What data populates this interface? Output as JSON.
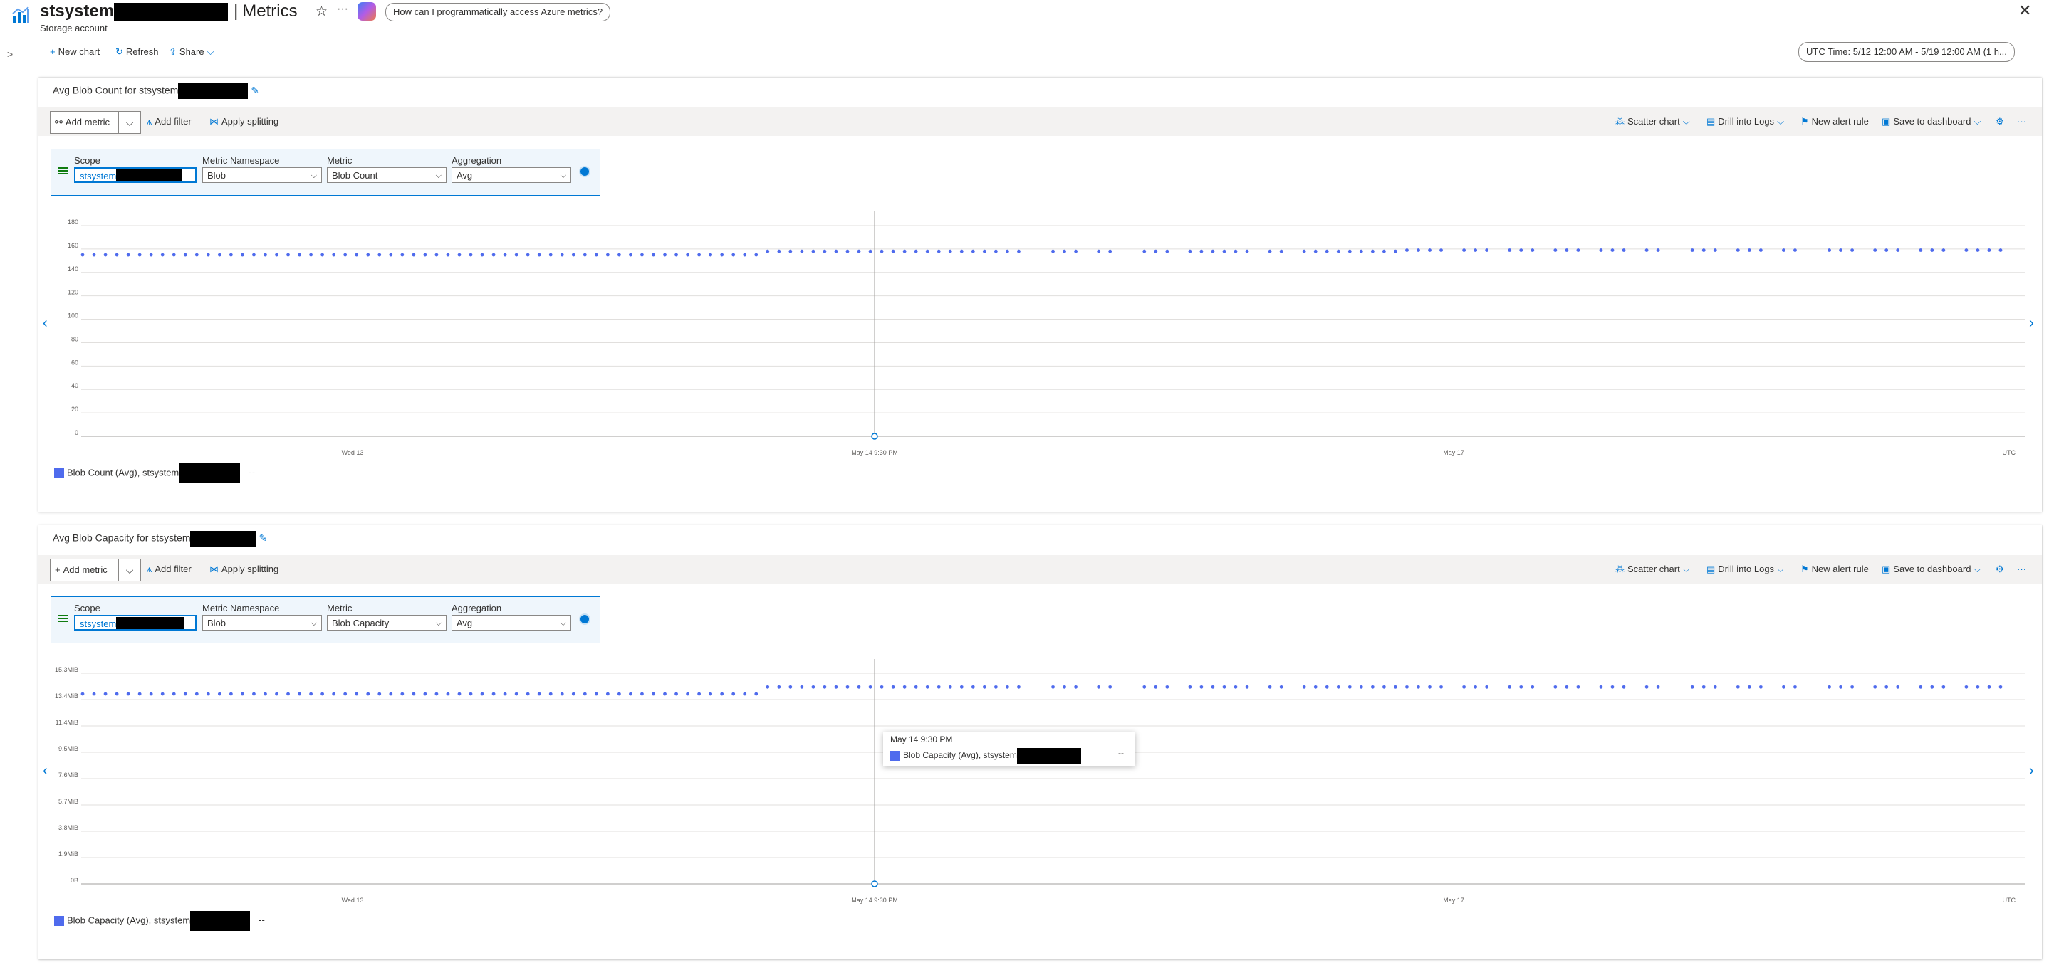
{
  "header": {
    "resource_name": "stsystem",
    "separator": "|",
    "page_title": "Metrics",
    "resource_type": "Storage account",
    "copilot_prompt": "How can I programmatically access Azure metrics?"
  },
  "toolbar": {
    "new_chart": "New chart",
    "refresh": "Refresh",
    "share": "Share",
    "time_range": "UTC Time: 5/12 12:00 AM - 5/19 12:00 AM (1 h..."
  },
  "chart_toolbar": {
    "add_metric": "Add metric",
    "add_filter": "Add filter",
    "apply_splitting": "Apply splitting",
    "scatter_chart": "Scatter chart",
    "drill_into_logs": "Drill into Logs",
    "new_alert_rule": "New alert rule",
    "save_to_dashboard": "Save to dashboard"
  },
  "metric_fields": {
    "scope_label": "Scope",
    "namespace_label": "Metric Namespace",
    "metric_label": "Metric",
    "aggregation_label": "Aggregation"
  },
  "charts": [
    {
      "title": "Avg Blob Count for stsystem",
      "scope_value": "stsystem",
      "namespace_value": "Blob",
      "metric_value": "Blob Count",
      "aggregation_value": "Avg",
      "legend_label": "Blob Count (Avg), stsystem",
      "legend_value": "--"
    },
    {
      "title": "Avg Blob Capacity for stsystem",
      "scope_value": "stsystem",
      "namespace_value": "Blob",
      "metric_value": "Blob Capacity",
      "aggregation_value": "Avg",
      "legend_label": "Blob Capacity (Avg), stsystem",
      "legend_value": "--"
    }
  ],
  "tooltip": {
    "time": "May 14 9:30 PM",
    "series": "Blob Capacity (Avg), stsystem",
    "value": "--"
  },
  "colors": {
    "series": "#4f6bed",
    "accent": "#0078d4"
  },
  "icons": [
    "chart-metrics-icon",
    "star-icon",
    "ellipsis-icon",
    "copilot-icon",
    "close-icon",
    "expand-chevron-icon",
    "plus-icon",
    "refresh-icon",
    "share-icon",
    "chevron-down-icon",
    "pencil-icon",
    "add-metric-icon",
    "filter-icon",
    "splitting-icon",
    "scatter-chart-icon",
    "drill-logs-icon",
    "alert-icon",
    "dashboard-icon",
    "gear-icon",
    "more-icon",
    "nav-left-icon",
    "nav-right-icon",
    "check-icon"
  ],
  "chart_data": [
    {
      "type": "scatter",
      "title": "Avg Blob Count for stsystem",
      "x_tick_labels": [
        "Wed 13",
        "May 14 9:30 PM",
        "May 17",
        "UTC"
      ],
      "y_tick_labels": [
        "0",
        "20",
        "40",
        "60",
        "80",
        "100",
        "120",
        "140",
        "160",
        "180"
      ],
      "ylim": [
        0,
        180
      ],
      "grid": true,
      "series": [
        {
          "name": "Blob Count (Avg), stsystem",
          "segments": [
            {
              "start": 0,
              "end": 59,
              "value": 155
            },
            {
              "start": 60,
              "end": 115,
              "value": 158
            },
            {
              "start": 116,
              "end": 168,
              "value": 159
            }
          ],
          "gaps": [
            83,
            84,
            88,
            91,
            92,
            96,
            103,
            106,
            120,
            124,
            128,
            132,
            136,
            139,
            140,
            144,
            148,
            151,
            152,
            156,
            160,
            164
          ]
        }
      ]
    },
    {
      "type": "scatter",
      "title": "Avg Blob Capacity for stsystem",
      "x_tick_labels": [
        "Wed 13",
        "May 14 9:30 PM",
        "May 17",
        "UTC"
      ],
      "y_tick_labels": [
        "0B",
        "1.9MiB",
        "3.8MiB",
        "5.7MiB",
        "7.6MiB",
        "9.5MiB",
        "11.4MiB",
        "13.4MiB",
        "15.3MiB"
      ],
      "ylim": [
        0,
        15.3
      ],
      "grid": true,
      "series": [
        {
          "name": "Blob Capacity (Avg), stsystem",
          "segments": [
            {
              "start": 0,
              "end": 59,
              "value": 13.8
            },
            {
              "start": 60,
              "end": 168,
              "value": 14.3
            }
          ],
          "gaps": [
            83,
            84,
            88,
            91,
            92,
            96,
            103,
            106,
            120,
            124,
            128,
            132,
            136,
            139,
            140,
            144,
            148,
            151,
            152,
            156,
            160,
            164
          ]
        }
      ]
    }
  ]
}
